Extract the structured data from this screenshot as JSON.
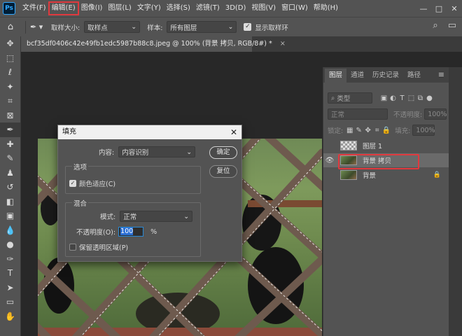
{
  "app": {
    "logo": "Ps"
  },
  "menu": [
    "文件(F)",
    "编辑(E)",
    "图像(I)",
    "图层(L)",
    "文字(Y)",
    "选择(S)",
    "滤镜(T)",
    "3D(D)",
    "视图(V)",
    "窗口(W)",
    "帮助(H)"
  ],
  "window_controls": [
    "—",
    "□",
    "✕"
  ],
  "options": {
    "sample_size_label": "取样大小:",
    "sample_size_value": "取样点",
    "sample_label": "样本:",
    "sample_value": "所有图层",
    "show_ring_label": "显示取样环"
  },
  "document_tab": {
    "title": "bcf35df0406c42e49fb1edc5987b88c8.jpeg @ 100% (背景 拷贝, RGB/8#) *",
    "close": "×"
  },
  "fill_dialog": {
    "title": "填充",
    "content_label": "内容:",
    "content_value": "内容识别",
    "ok_label": "确定",
    "reset_label": "复位",
    "options_group": "选项",
    "color_adapt_label": "颜色适应(C)",
    "blend_group": "混合",
    "mode_label": "模式:",
    "mode_value": "正常",
    "opacity_label": "不透明度(O):",
    "opacity_value": "100",
    "opacity_unit": "%",
    "preserve_label": "保留透明区域(P)"
  },
  "layers_panel": {
    "tabs": [
      "图层",
      "通道",
      "历史记录",
      "路径"
    ],
    "filter_placeholder": "类型",
    "blend_mode": "正常",
    "opacity_label": "不透明度:",
    "opacity_value": "100%",
    "lock_label": "锁定:",
    "fill_label": "填充:",
    "fill_value": "100%",
    "layers": [
      {
        "name": "图层 1",
        "selected": false,
        "visible": false
      },
      {
        "name": "背景 拷贝",
        "selected": true,
        "visible": true
      },
      {
        "name": "背景",
        "selected": false,
        "visible": false,
        "locked": true
      }
    ]
  }
}
